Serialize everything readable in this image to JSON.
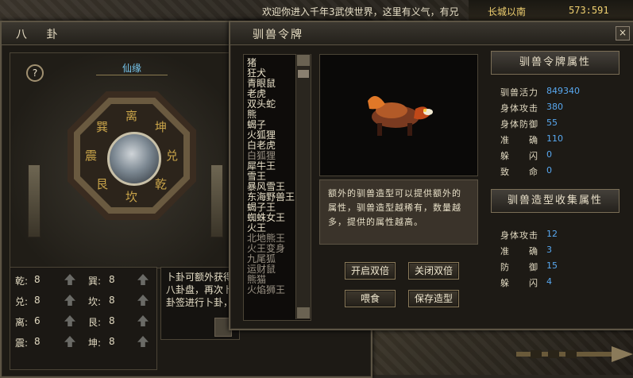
{
  "chat": "欢迎你进入千年3武侠世界，这里有义气，有兄",
  "location": {
    "name": "长城以南",
    "coords": "573:591"
  },
  "bagua": {
    "title": "八 卦",
    "close": "×",
    "help": "?",
    "tab": "仙缘",
    "trigrams": [
      "离",
      "坤",
      "兑",
      "乾",
      "坎",
      "艮",
      "震",
      "巽"
    ],
    "stats": [
      {
        "label": "乾:",
        "value": "8"
      },
      {
        "label": "巽:",
        "value": "8"
      },
      {
        "label": "兑:",
        "value": "8"
      },
      {
        "label": "坎:",
        "value": "8"
      },
      {
        "label": "离:",
        "value": "6"
      },
      {
        "label": "艮:",
        "value": "8"
      },
      {
        "label": "震:",
        "value": "8"
      },
      {
        "label": "坤:",
        "value": "8"
      }
    ],
    "desc": "卜卦可额外获得八卦盘，再次卜卦签进行卜卦，"
  },
  "beast": {
    "title": "驯兽令牌",
    "close": "×",
    "list": [
      "猪",
      "狂犬",
      "青眼鼠",
      "老虎",
      "双头蛇",
      "熊",
      "蝎子",
      "火狐狸",
      "白老虎",
      "白狐狸",
      "犀牛王",
      "雪王",
      "暴风雪王",
      "东海野兽王",
      "蝎子王",
      "蜘蛛女王",
      "火王",
      "北地熊王",
      "火王变身",
      "九尾狐",
      "运财鼠",
      "熊猫",
      "火焰狮王"
    ],
    "info": "额外的驯兽造型可以提供额外的属性，驯兽造型越稀有，数量越多，提供的属性越高。",
    "buttons": {
      "open_double": "开启双倍",
      "close_double": "关闭双倍",
      "feed": "喂食",
      "save_shape": "保存造型"
    },
    "token_attr_title": "驯兽令牌属性",
    "token_attrs": [
      {
        "k": "驯兽活力",
        "v": "849340"
      },
      {
        "k": "身体攻击",
        "v": "380"
      },
      {
        "k": "身体防御",
        "v": "55"
      },
      {
        "k": "准　　确",
        "v": "110"
      },
      {
        "k": "躲　　闪",
        "v": "0"
      },
      {
        "k": "致　　命",
        "v": "0"
      }
    ],
    "shape_attr_title": "驯兽造型收集属性",
    "shape_attrs": [
      {
        "k": "身体攻击",
        "v": "12"
      },
      {
        "k": "准　　确",
        "v": "3"
      },
      {
        "k": "防　　御",
        "v": "15"
      },
      {
        "k": "躲　　闪",
        "v": "4"
      }
    ]
  }
}
